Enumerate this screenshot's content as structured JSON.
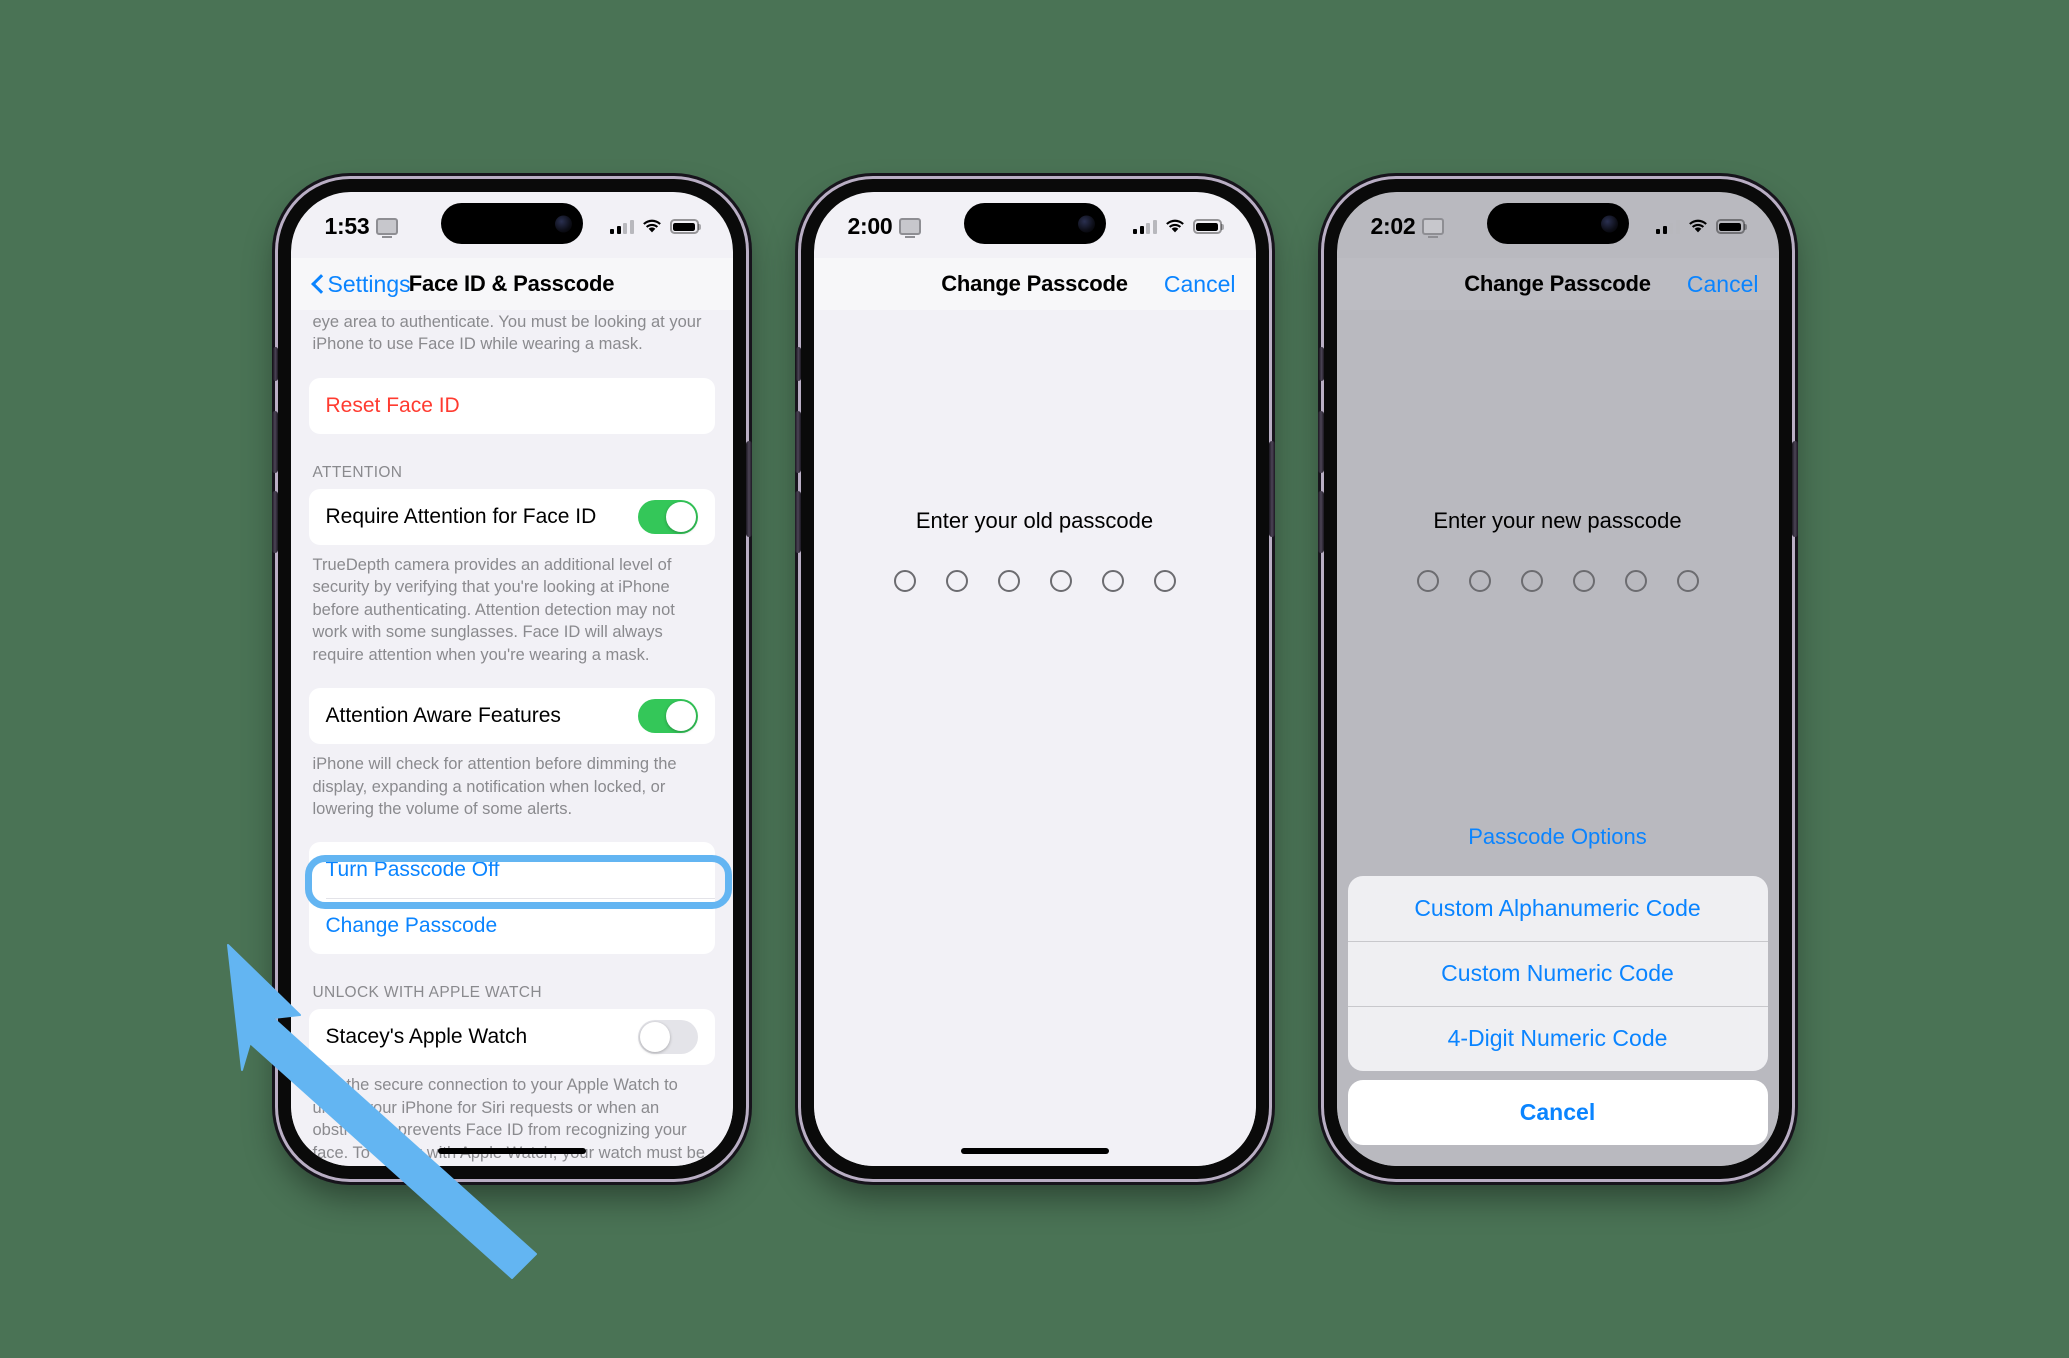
{
  "accent": {
    "blue": "#0a84ff",
    "red": "#ff3b30",
    "green": "#34c759",
    "highlight": "#63b5f2",
    "backdrop": "#4a7355"
  },
  "phones": [
    {
      "id": "settings",
      "status": {
        "time": "1:53",
        "screen_mirror_icon": "screen-icon",
        "signal_icon": "cellular-signal-icon",
        "wifi_icon": "wifi-icon",
        "battery_icon": "battery-icon"
      },
      "nav": {
        "back_label": "Settings",
        "back_icon": "chevron-left-icon",
        "title": "Face ID & Passcode"
      },
      "content": {
        "top_footnote": "eye area to authenticate. You must be looking at your iPhone to use Face ID while wearing a mask.",
        "reset_row": "Reset Face ID",
        "attention_header": "ATTENTION",
        "require_attention_row": "Require Attention for Face ID",
        "require_attention_value": "on",
        "require_attention_footnote": "TrueDepth camera provides an additional level of security by verifying that you're looking at iPhone before authenticating. Attention detection may not work with some sunglasses. Face ID will always require attention when you're wearing a mask.",
        "attention_aware_row": "Attention Aware Features",
        "attention_aware_value": "on",
        "attention_aware_footnote": "iPhone will check for attention before dimming the display, expanding a notification when locked, or lowering the volume of some alerts.",
        "turn_passcode_off_row": "Turn Passcode Off",
        "change_passcode_row": "Change Passcode",
        "watch_header": "UNLOCK WITH APPLE WATCH",
        "watch_row": "Stacey's Apple Watch",
        "watch_value": "off",
        "watch_footnote": "Use the secure connection to your Apple Watch to unlock your iPhone for Siri requests or when an obstruction prevents Face ID from recognizing your face. To unlock with Apple Watch, your watch must be passcode protected, unlocked, and on your wrist close by."
      }
    },
    {
      "id": "old-passcode",
      "status": {
        "time": "2:00"
      },
      "nav": {
        "title": "Change Passcode",
        "cancel_label": "Cancel"
      },
      "content": {
        "prompt": "Enter your old passcode",
        "dots": 6
      }
    },
    {
      "id": "new-passcode",
      "status": {
        "time": "2:02"
      },
      "nav": {
        "title": "Change Passcode",
        "cancel_label": "Cancel"
      },
      "content": {
        "prompt": "Enter your new passcode",
        "dots": 6,
        "passcode_options_label": "Passcode Options",
        "sheet": {
          "options": [
            "Custom Alphanumeric Code",
            "Custom Numeric Code",
            "4-Digit Numeric Code"
          ],
          "cancel": "Cancel"
        }
      }
    }
  ]
}
